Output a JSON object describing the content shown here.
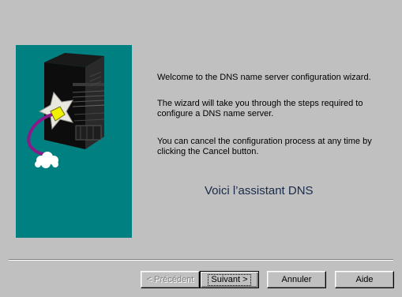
{
  "wizard": {
    "paragraphs": {
      "welcome": "Welcome to the DNS name server configuration wizard.",
      "steps": "The wizard will take you through the steps required to configure a DNS name server.",
      "cancel_info": "You can cancel the configuration process at any time by clicking the Cancel button."
    },
    "headline": "Voici l’assistant DNS",
    "buttons": {
      "back": "< Précédent",
      "next": "Suivant >",
      "cancel": "Annuler",
      "help": "Aide"
    }
  },
  "colors": {
    "dialog_background": "#c0c0c0",
    "side_panel": "#008080",
    "headline": "#1a2a4a"
  },
  "icons": {
    "illustration": "server-tower-with-connector-illustration"
  }
}
